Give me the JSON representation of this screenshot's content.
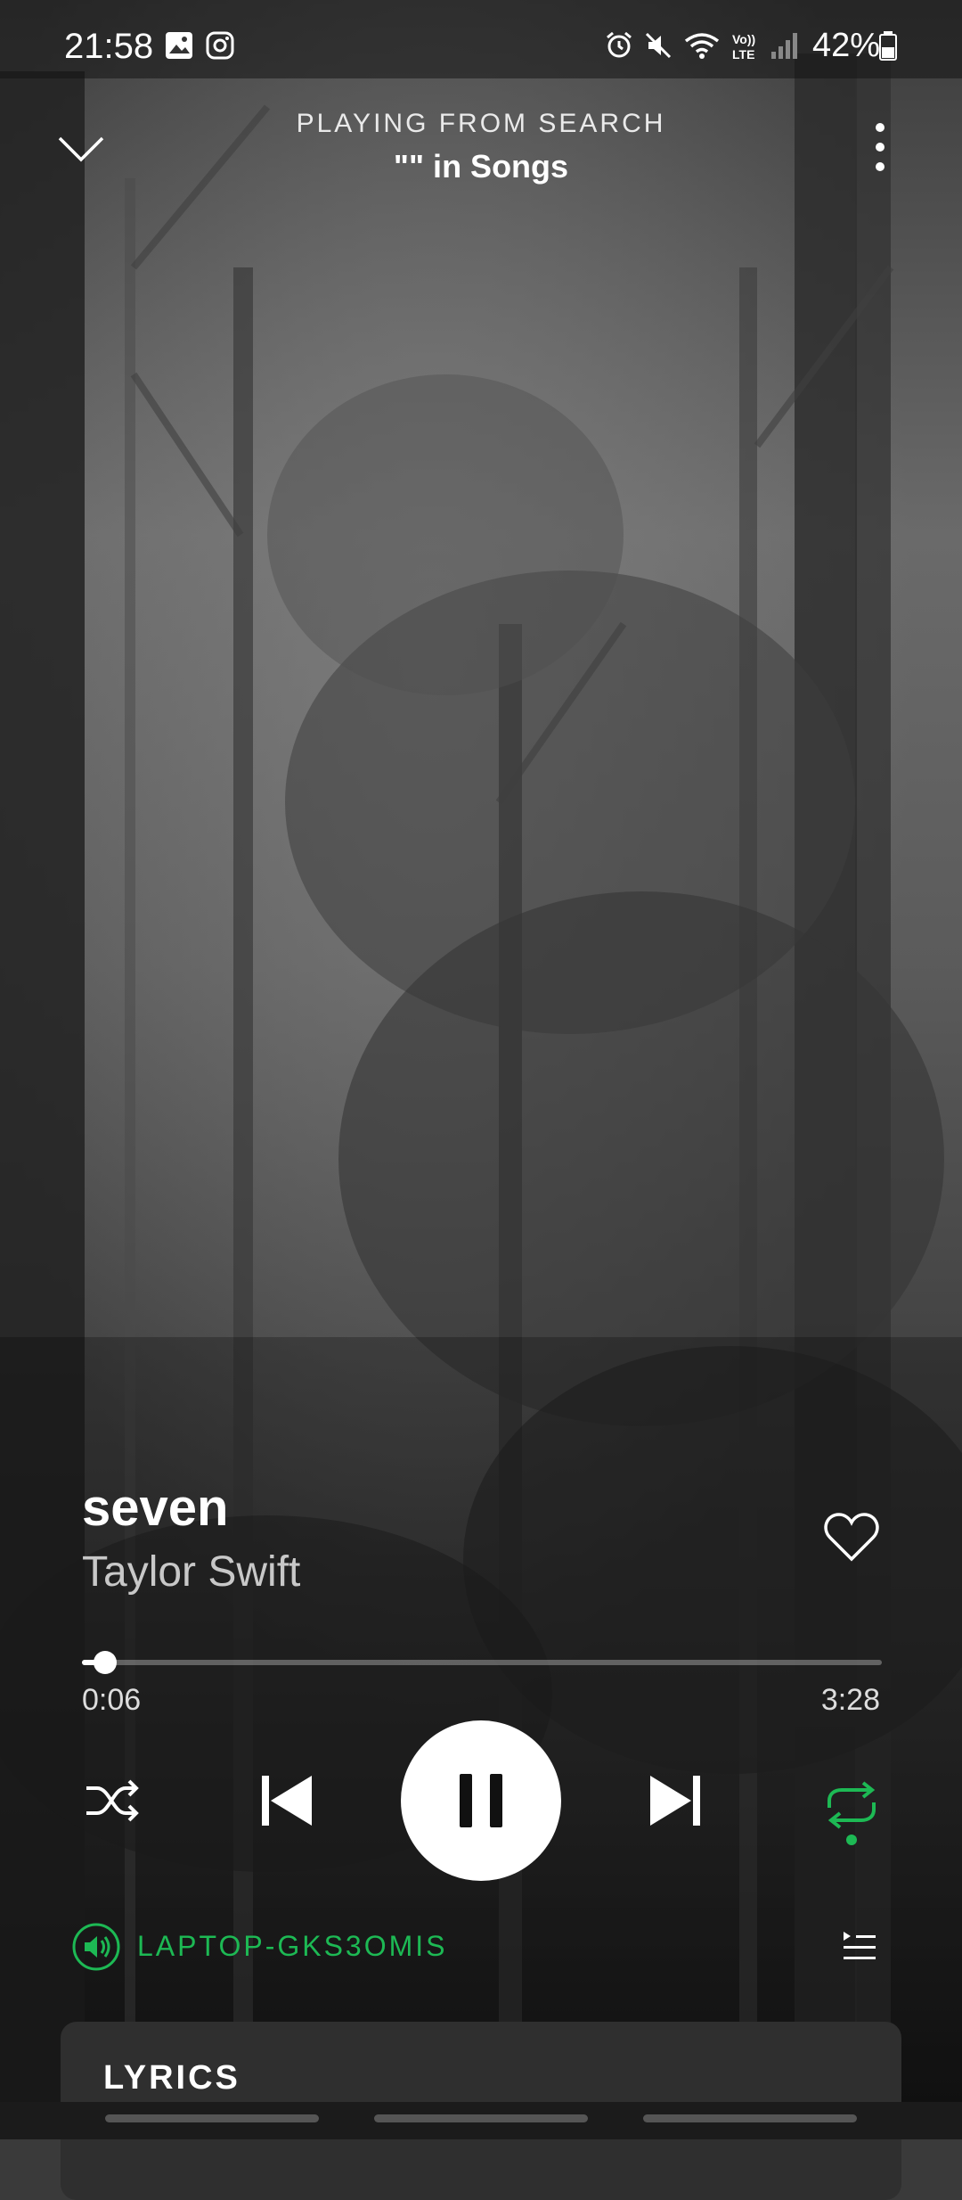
{
  "status_bar": {
    "time": "21:58",
    "battery": "42%",
    "icons": [
      "gallery-icon",
      "instagram-icon",
      "alarm-icon",
      "mute-icon",
      "wifi-icon",
      "volte-icon",
      "signal-icon",
      "battery-icon"
    ]
  },
  "header": {
    "context_label": "PLAYING FROM SEARCH",
    "source": "\"\" in Songs"
  },
  "track": {
    "title": "seven",
    "artist": "Taylor Swift",
    "liked": false
  },
  "progress": {
    "elapsed": "0:06",
    "total": "3:28",
    "fraction": 0.029
  },
  "controls": {
    "shuffle": false,
    "repeat": true,
    "playing": true
  },
  "device": {
    "name": "LAPTOP-GKS3OMIS"
  },
  "lyrics": {
    "label": "LYRICS"
  },
  "colors": {
    "accent": "#1db954",
    "card": "#2f2f2f"
  }
}
